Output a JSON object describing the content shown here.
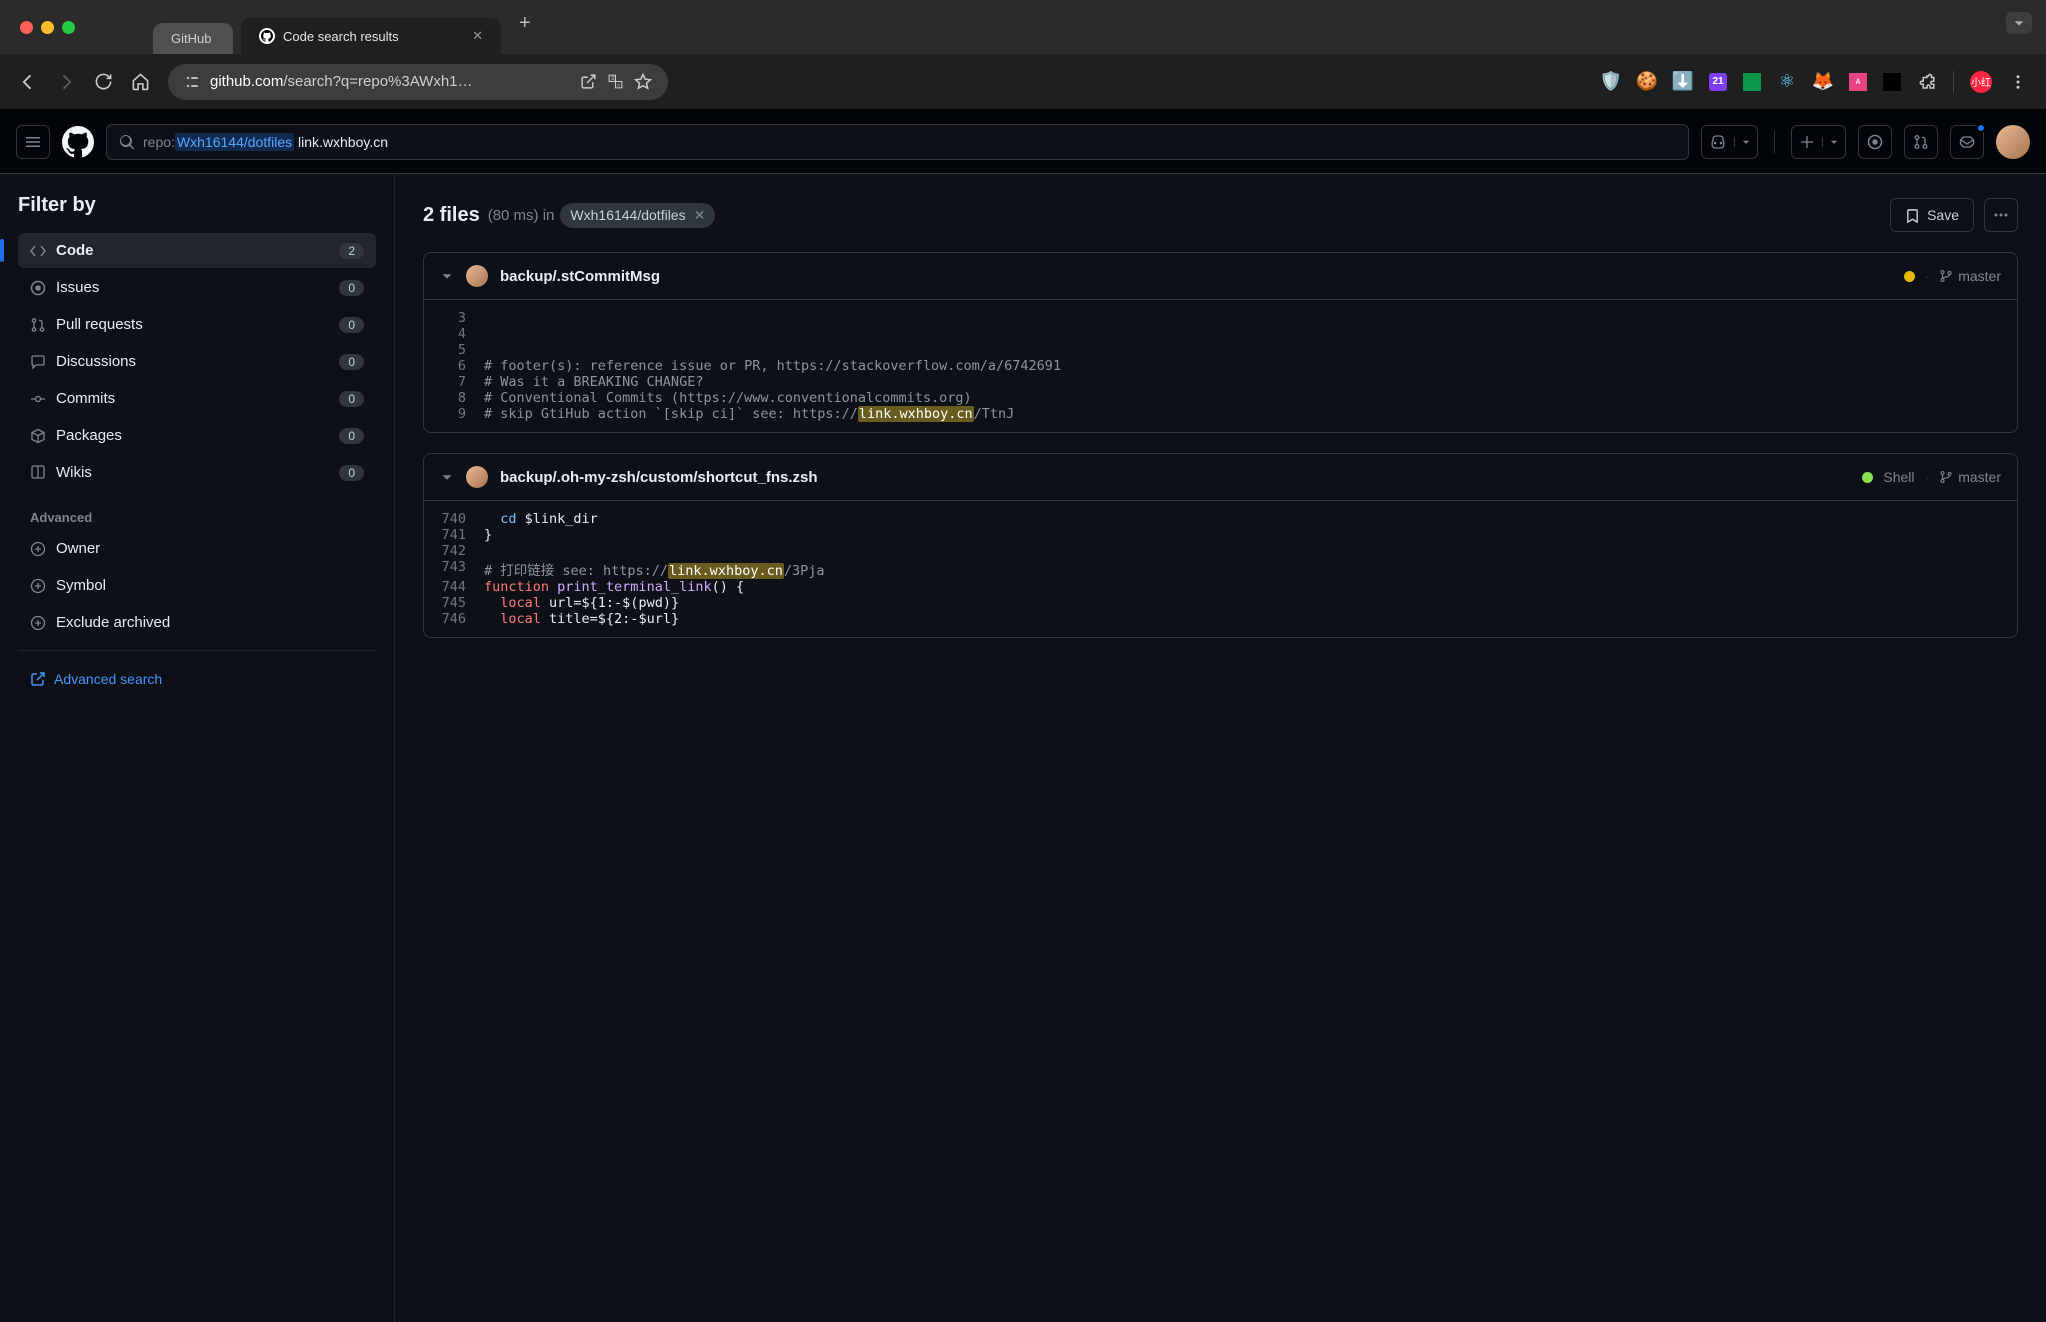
{
  "browser": {
    "tabs": [
      {
        "label": "GitHub",
        "active": false
      },
      {
        "label": "Code search results",
        "active": true
      }
    ],
    "url_domain": "github.com",
    "url_path": "/search?q=repo%3AWxh1…",
    "ext_cal": "21",
    "ext_xh": "小红"
  },
  "gh": {
    "search_qualifier": "repo:",
    "search_repo": "Wxh16144/dotfiles",
    "search_term": "link.wxhboy.cn"
  },
  "sidebar": {
    "title": "Filter by",
    "items": [
      {
        "label": "Code",
        "count": "2",
        "active": true
      },
      {
        "label": "Issues",
        "count": "0"
      },
      {
        "label": "Pull requests",
        "count": "0"
      },
      {
        "label": "Discussions",
        "count": "0"
      },
      {
        "label": "Commits",
        "count": "0"
      },
      {
        "label": "Packages",
        "count": "0"
      },
      {
        "label": "Wikis",
        "count": "0"
      }
    ],
    "advanced_label": "Advanced",
    "adv_items": [
      {
        "label": "Owner"
      },
      {
        "label": "Symbol"
      },
      {
        "label": "Exclude archived"
      }
    ],
    "adv_search_link": "Advanced search"
  },
  "results": {
    "count_label": "2 files",
    "timing": "(80 ms)",
    "in_label": "in",
    "repo_chip": "Wxh16144/dotfiles",
    "save_label": "Save"
  },
  "result1": {
    "path": "backup/.stCommitMsg",
    "branch": "master"
  },
  "result2": {
    "path": "backup/.oh-my-zsh/custom/shortcut_fns.zsh",
    "lang": "Shell",
    "branch": "master"
  },
  "code1": {
    "l3n": "3",
    "l3": "",
    "l4n": "4",
    "l4": "",
    "l5n": "5",
    "l5": "",
    "l6n": "6",
    "l6": "# footer(s): reference issue or PR, https://stackoverflow.com/a/6742691",
    "l7n": "7",
    "l7": "# Was it a BREAKING CHANGE?",
    "l8n": "8",
    "l8": "# Conventional Commits (https://www.conventionalcommits.org)",
    "l9n": "9",
    "l9a": "# skip GtiHub action `[skip ci]` see: https://",
    "l9h": "link.wxhboy.cn",
    "l9b": "/TtnJ"
  },
  "code2": {
    "l740n": "740",
    "l740_cd": "cd",
    "l740_rest": " $link_dir",
    "l741n": "741",
    "l741": "}",
    "l742n": "742",
    "l743n": "743",
    "l743a": "# 打印链接 see: https://",
    "l743h": "link.wxhboy.cn",
    "l743b": "/3Pja",
    "l744n": "744",
    "l744_fn": "function",
    "l744_name": " print_terminal_link",
    "l744_rest": "() {",
    "l745n": "745",
    "l745_local": "local",
    "l745_rest": " url=${1:-$(pwd)}",
    "l746n": "746",
    "l746_local": "local",
    "l746_rest": " title=${2:-$url}"
  }
}
